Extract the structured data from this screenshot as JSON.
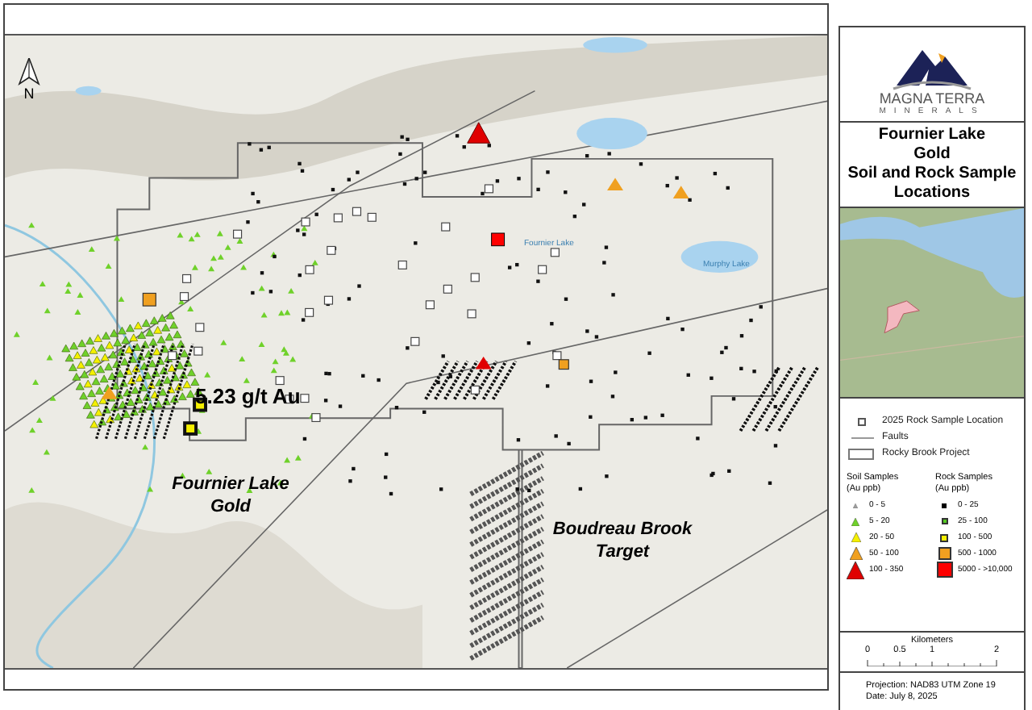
{
  "map": {
    "north_arrow": "N",
    "labels": [
      {
        "text": "Fournier Lake",
        "kind": "lake"
      },
      {
        "text": "Murphy Lake",
        "kind": "lake"
      },
      {
        "text": "5.23 g/t Au",
        "kind": "grade"
      },
      {
        "text": "Fournier Lake Gold",
        "kind": "target"
      },
      {
        "text": "Boudreau Brook Target",
        "kind": "target"
      }
    ]
  },
  "panel": {
    "logo": {
      "name": "MAGNA TERRA",
      "sub": "MINERALS"
    },
    "title": [
      "Fournier Lake",
      "Gold",
      "Soil and Rock Sample",
      "Locations"
    ],
    "legend": {
      "items": [
        {
          "label": "2025 Rock Sample Location",
          "kind": "square"
        },
        {
          "label": "Faults",
          "kind": "line"
        },
        {
          "label": "Rocky Brook Project",
          "kind": "outline"
        }
      ],
      "soil": {
        "title": "Soil Samples",
        "unit": "(Au ppb)",
        "items": [
          {
            "label": "0 - 5",
            "color": "#9e9e9e"
          },
          {
            "label": "5 - 20",
            "color": "#6fd12a"
          },
          {
            "label": "20 - 50",
            "color": "#f5f000"
          },
          {
            "label": "50 - 100",
            "color": "#f0a020"
          },
          {
            "label": "100 - 350",
            "color": "#e00000"
          }
        ]
      },
      "rock": {
        "title": "Rock Samples",
        "unit": "(Au ppb)",
        "items": [
          {
            "label": "0 - 25",
            "color": "#000000"
          },
          {
            "label": "25 - 100",
            "color": "#55cc22"
          },
          {
            "label": "100 - 500",
            "color": "#f5f000"
          },
          {
            "label": "500 - 1000",
            "color": "#f0a020"
          },
          {
            "label": "5000 - >10,000",
            "color": "#ff0000"
          }
        ]
      }
    },
    "scale": {
      "title": "Kilometers",
      "ticks": [
        "0",
        "0.5",
        "1",
        "2"
      ]
    },
    "footer": [
      "Projection: NAD83 UTM Zone 19",
      "Date: July 8, 2025"
    ]
  }
}
